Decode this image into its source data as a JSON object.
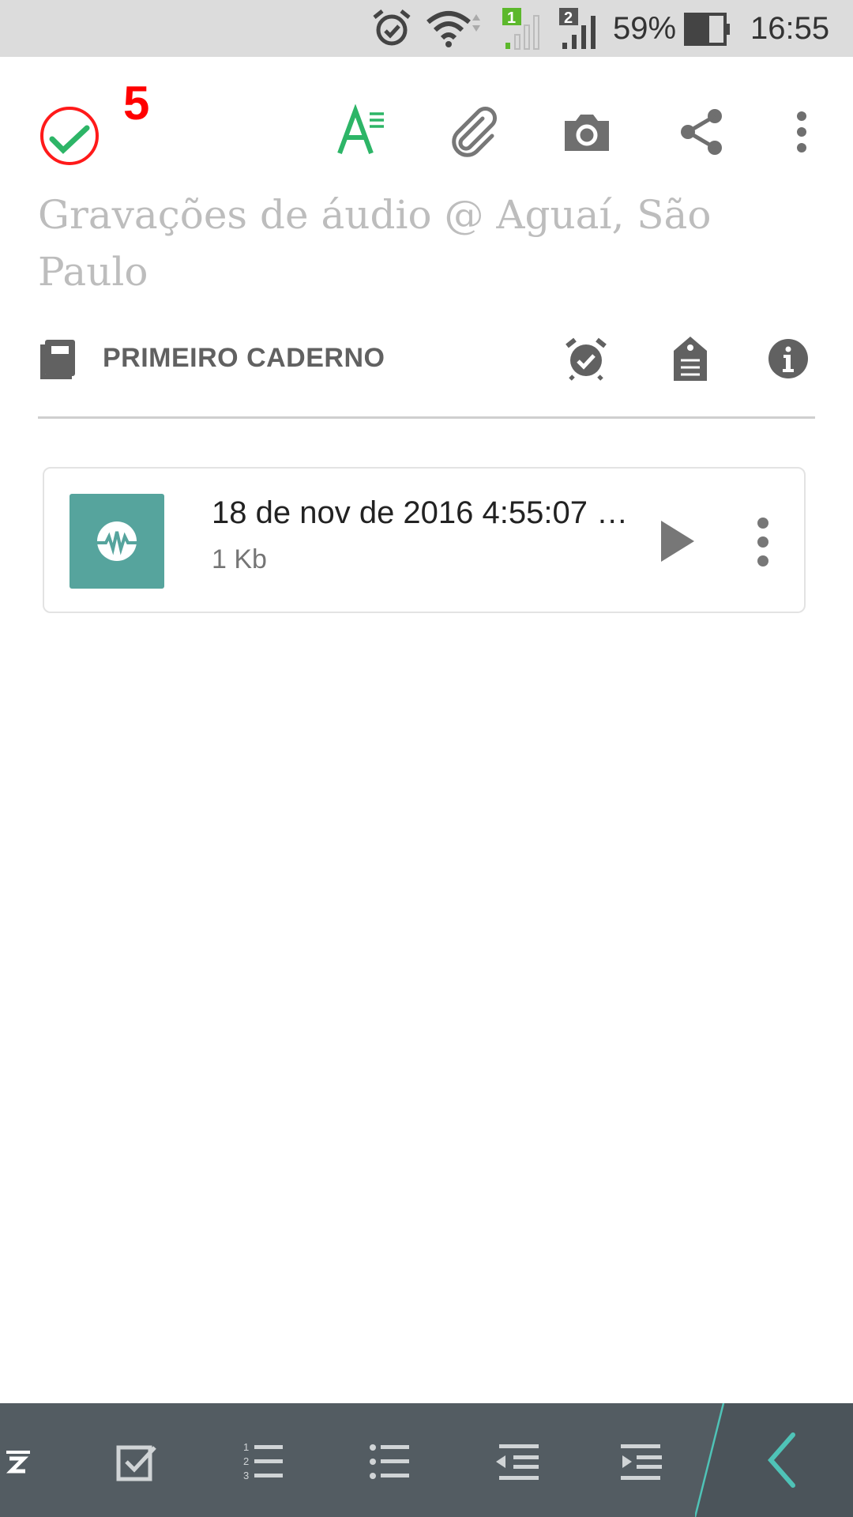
{
  "status_bar": {
    "battery_percent": "59%",
    "time": "16:55",
    "sim1_label": "1",
    "sim2_label": "2"
  },
  "toolbar": {
    "annotation_number": "5",
    "icons": [
      "checkmark-icon",
      "text-format-icon",
      "paperclip-icon",
      "camera-icon",
      "share-icon",
      "more-vertical-icon"
    ]
  },
  "note": {
    "title": "Gravações de áudio @ Aguaí, São Paulo"
  },
  "meta": {
    "notebook": "PRIMEIRO CADERNO",
    "icons": [
      "notebook-icon",
      "reminder-icon",
      "tag-icon",
      "info-icon"
    ]
  },
  "attachment": {
    "name": "18 de nov de 2016 4:55:07 …",
    "size": "1 Kb"
  },
  "format_bar": {
    "icons": [
      "highlight-icon",
      "checkbox-icon",
      "numbered-list-icon",
      "bulleted-list-icon",
      "outdent-icon",
      "indent-icon",
      "collapse-chevron-icon"
    ]
  },
  "colors": {
    "accent_green": "#2db567",
    "annotation_red": "#ff0000",
    "audio_thumb": "#56a49d",
    "format_bar_bg": "#535c62",
    "teal_accent": "#4fc3b7"
  }
}
